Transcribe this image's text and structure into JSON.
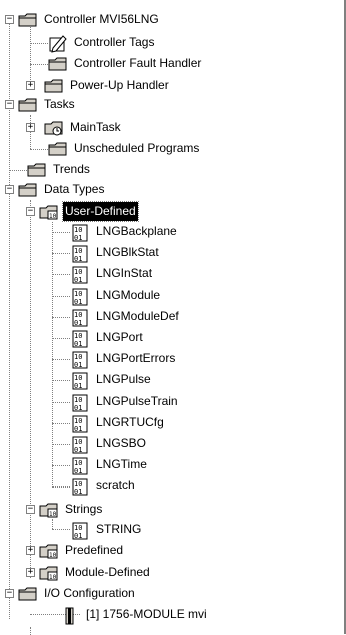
{
  "tree": {
    "controller": {
      "label": "Controller MVI56LNG",
      "expander": "−"
    },
    "controller_tags": {
      "label": "Controller Tags"
    },
    "fault_handler": {
      "label": "Controller Fault Handler"
    },
    "powerup_handler": {
      "label": "Power-Up Handler",
      "expander": "+"
    },
    "tasks": {
      "label": "Tasks",
      "expander": "−"
    },
    "main_task": {
      "label": "MainTask",
      "expander": "+"
    },
    "unscheduled": {
      "label": "Unscheduled Programs"
    },
    "trends": {
      "label": "Trends"
    },
    "data_types": {
      "label": "Data Types",
      "expander": "−"
    },
    "user_defined": {
      "label": "User-Defined",
      "expander": "−",
      "selected": true
    },
    "udts": [
      "LNGBackplane",
      "LNGBlkStat",
      "LNGInStat",
      "LNGModule",
      "LNGModuleDef",
      "LNGPort",
      "LNGPortErrors",
      "LNGPulse",
      "LNGPulseTrain",
      "LNGRTUCfg",
      "LNGSBO",
      "LNGTime",
      "scratch"
    ],
    "strings": {
      "label": "Strings",
      "expander": "−"
    },
    "string_item": {
      "label": "STRING"
    },
    "predefined": {
      "label": "Predefined",
      "expander": "+"
    },
    "module_defined": {
      "label": "Module-Defined",
      "expander": "+"
    },
    "io_config": {
      "label": "I/O Configuration",
      "expander": "−"
    },
    "module": {
      "label": "[1] 1756-MODULE mvi"
    }
  },
  "colors": {
    "folder_fill": "#d4d0c8",
    "selection": "#000000",
    "dotted_line": "#808080"
  },
  "icons": {
    "folder": "folder-icon",
    "tags": "tags-icon",
    "task": "task-icon",
    "datatype": "datatype-icon",
    "module": "module-icon"
  }
}
